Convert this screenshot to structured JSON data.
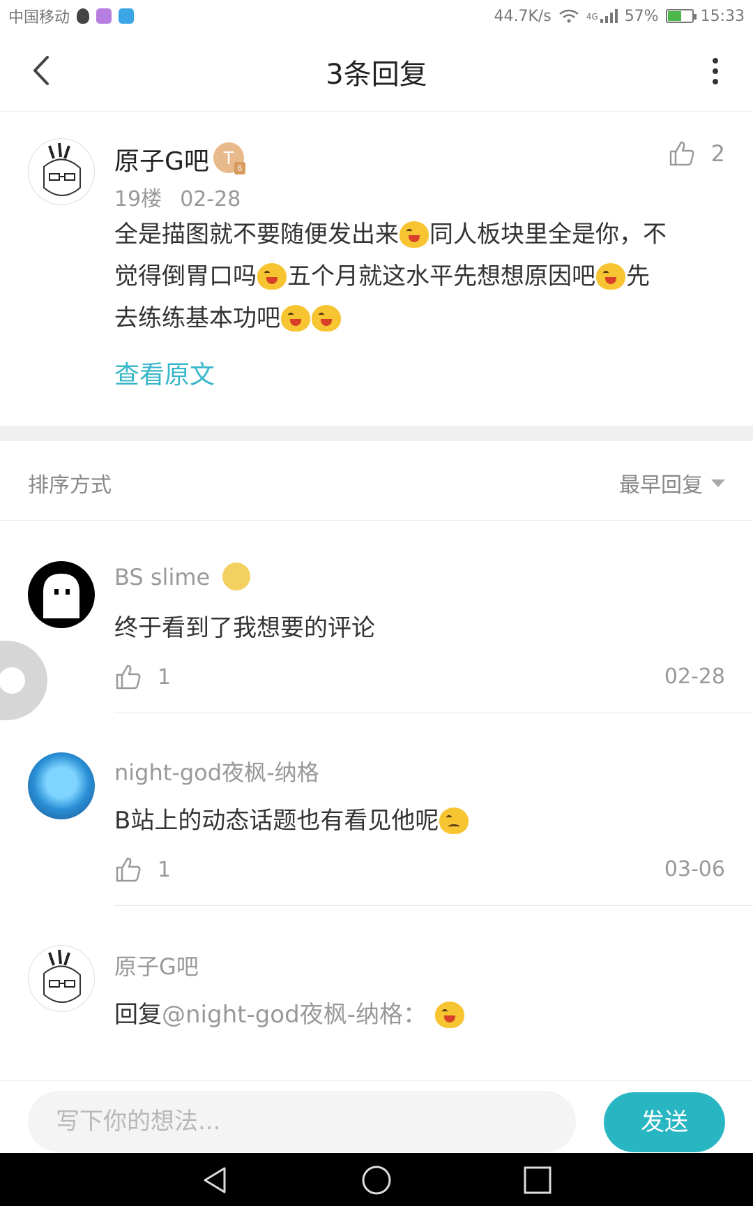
{
  "status_bar": {
    "carrier": "中国移动",
    "speed": "44.7K/s",
    "network": "4G",
    "battery": "57%",
    "battery_level": 0.57,
    "time": "15:33"
  },
  "header": {
    "title": "3条回复"
  },
  "post": {
    "author": "原子G吧",
    "badge": "T",
    "badge_level": "6",
    "floor": "19楼",
    "date": "02-28",
    "like_count": "2",
    "content_lines": [
      [
        "全是描图就不要随便发出来",
        "[emoji]",
        "同人板块里全是你，不"
      ],
      [
        "觉得倒胃口吗",
        "[emoji]",
        "五个月就这水平先想想原因吧",
        "[emoji]",
        "先"
      ],
      [
        "去练练基本功吧",
        "[emoji]",
        "[emoji]"
      ]
    ],
    "view_original": "查看原文"
  },
  "sort": {
    "label": "排序方式",
    "value": "最早回复"
  },
  "replies": [
    {
      "author": "BS slime",
      "text": "终于看到了我想要的评论",
      "like_count": "1",
      "date": "02-28"
    },
    {
      "author": "night-god夜枫-纳格",
      "text": "B站上的动态话题也有看见他呢",
      "like_count": "1",
      "date": "03-06"
    },
    {
      "author": "原子G吧",
      "reply_prefix": "回复",
      "mention": "@night-god夜枫-纳格：",
      "text": ""
    }
  ],
  "input": {
    "placeholder": "写下你的想法...",
    "send_label": "发送"
  },
  "colors": {
    "accent": "#29b6c3",
    "link": "#38b6c9",
    "muted": "#999999"
  }
}
